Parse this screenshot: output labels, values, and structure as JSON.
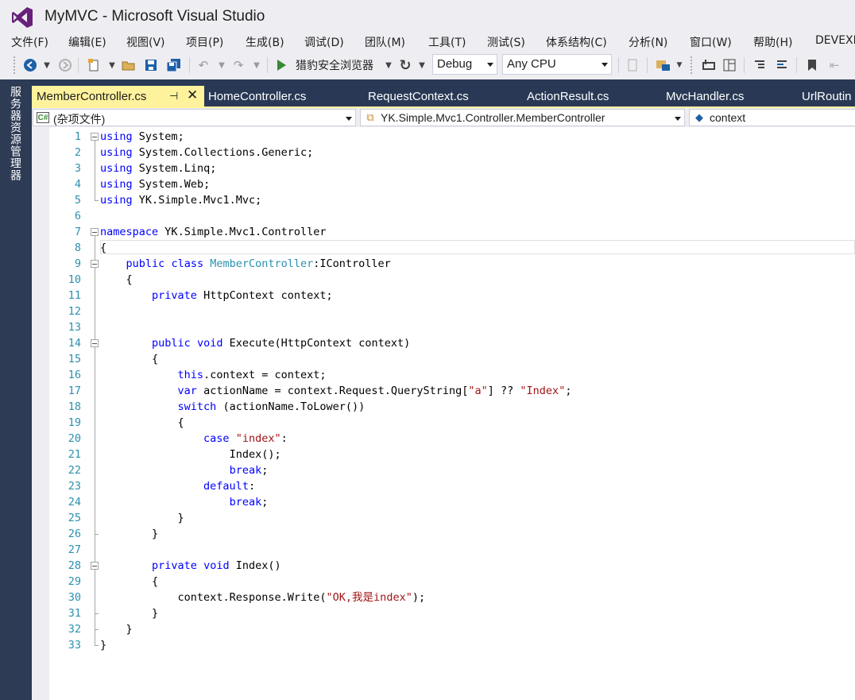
{
  "window": {
    "title": "MyMVC - Microsoft Visual Studio"
  },
  "menu": [
    "文件(F)",
    "编辑(E)",
    "视图(V)",
    "项目(P)",
    "生成(B)",
    "调试(D)",
    "团队(M)",
    "工具(T)",
    "测试(S)",
    "体系结构(C)",
    "分析(N)",
    "窗口(W)",
    "帮助(H)",
    "DEVEXP"
  ],
  "toolbar": {
    "run_label": "猎豹安全浏览器",
    "config": "Debug",
    "platform": "Any CPU",
    "icons": [
      "back-icon",
      "forward-icon",
      "new-project-icon",
      "open-icon",
      "save-icon",
      "save-all-icon",
      "undo-icon",
      "redo-icon",
      "start-icon",
      "refresh-icon",
      "find-icon",
      "bookmark-icon"
    ]
  },
  "side_panel": {
    "label": "服务器资源管理器"
  },
  "tabs": [
    {
      "label": "MemberController.cs",
      "active": true
    },
    {
      "label": "HomeController.cs",
      "active": false
    },
    {
      "label": "RequestContext.cs",
      "active": false
    },
    {
      "label": "ActionResult.cs",
      "active": false
    },
    {
      "label": "MvcHandler.cs",
      "active": false
    },
    {
      "label": "UrlRoutin",
      "active": false
    }
  ],
  "nav": {
    "project": "(杂项文件)",
    "type": "YK.Simple.Mvc1.Controller.MemberController",
    "member": "context"
  },
  "editor": {
    "line_numbers": [
      "1",
      "2",
      "3",
      "4",
      "5",
      "6",
      "7",
      "8",
      "9",
      "10",
      "11",
      "12",
      "13",
      "14",
      "15",
      "16",
      "17",
      "18",
      "19",
      "20",
      "21",
      "22",
      "23",
      "24",
      "25",
      "26",
      "27",
      "28",
      "29",
      "30",
      "31",
      "32",
      "33"
    ],
    "lines": [
      "using System;",
      "using System.Collections.Generic;",
      "using System.Linq;",
      "using System.Web;",
      "using YK.Simple.Mvc1.Mvc;",
      "",
      "namespace YK.Simple.Mvc1.Controller",
      "{",
      "    public class MemberController:IController",
      "    {",
      "        private HttpContext context;",
      "",
      "",
      "        public void Execute(HttpContext context)",
      "        {",
      "            this.context = context;",
      "            var actionName = context.Request.QueryString[\"a\"] ?? \"Index\";",
      "            switch (actionName.ToLower())",
      "            {",
      "                case \"index\":",
      "                    Index();",
      "                    break;",
      "                default:",
      "                    break;",
      "            }",
      "        }",
      "",
      "        private void Index()",
      "        {",
      "            context.Response.Write(\"OK,我是index\");",
      "        }",
      "    }",
      "}"
    ]
  },
  "colors": {
    "keyword": "#0000ff",
    "type": "#2b91af",
    "string": "#a31515",
    "line_number": "#2b91af",
    "tab_active": "#fff29d",
    "tab_bar": "#293955",
    "vs_purple": "#68217a"
  }
}
